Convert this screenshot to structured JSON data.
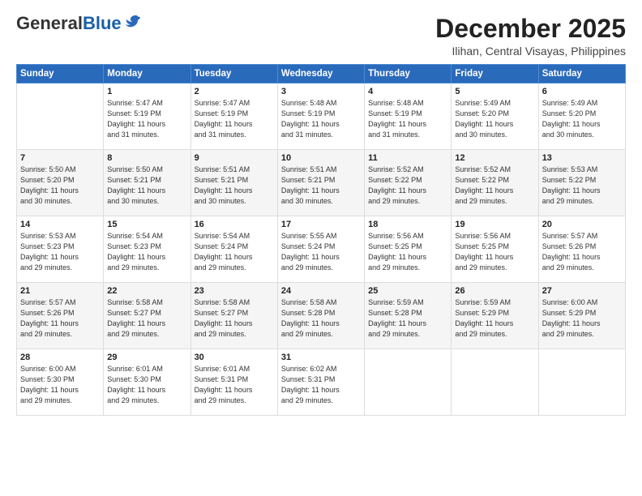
{
  "header": {
    "logo_general": "General",
    "logo_blue": "Blue",
    "month": "December 2025",
    "location": "Ilihan, Central Visayas, Philippines"
  },
  "days_of_week": [
    "Sunday",
    "Monday",
    "Tuesday",
    "Wednesday",
    "Thursday",
    "Friday",
    "Saturday"
  ],
  "weeks": [
    [
      {
        "day": "",
        "info": ""
      },
      {
        "day": "1",
        "info": "Sunrise: 5:47 AM\nSunset: 5:19 PM\nDaylight: 11 hours\nand 31 minutes."
      },
      {
        "day": "2",
        "info": "Sunrise: 5:47 AM\nSunset: 5:19 PM\nDaylight: 11 hours\nand 31 minutes."
      },
      {
        "day": "3",
        "info": "Sunrise: 5:48 AM\nSunset: 5:19 PM\nDaylight: 11 hours\nand 31 minutes."
      },
      {
        "day": "4",
        "info": "Sunrise: 5:48 AM\nSunset: 5:19 PM\nDaylight: 11 hours\nand 31 minutes."
      },
      {
        "day": "5",
        "info": "Sunrise: 5:49 AM\nSunset: 5:20 PM\nDaylight: 11 hours\nand 30 minutes."
      },
      {
        "day": "6",
        "info": "Sunrise: 5:49 AM\nSunset: 5:20 PM\nDaylight: 11 hours\nand 30 minutes."
      }
    ],
    [
      {
        "day": "7",
        "info": "Sunrise: 5:50 AM\nSunset: 5:20 PM\nDaylight: 11 hours\nand 30 minutes."
      },
      {
        "day": "8",
        "info": "Sunrise: 5:50 AM\nSunset: 5:21 PM\nDaylight: 11 hours\nand 30 minutes."
      },
      {
        "day": "9",
        "info": "Sunrise: 5:51 AM\nSunset: 5:21 PM\nDaylight: 11 hours\nand 30 minutes."
      },
      {
        "day": "10",
        "info": "Sunrise: 5:51 AM\nSunset: 5:21 PM\nDaylight: 11 hours\nand 30 minutes."
      },
      {
        "day": "11",
        "info": "Sunrise: 5:52 AM\nSunset: 5:22 PM\nDaylight: 11 hours\nand 29 minutes."
      },
      {
        "day": "12",
        "info": "Sunrise: 5:52 AM\nSunset: 5:22 PM\nDaylight: 11 hours\nand 29 minutes."
      },
      {
        "day": "13",
        "info": "Sunrise: 5:53 AM\nSunset: 5:22 PM\nDaylight: 11 hours\nand 29 minutes."
      }
    ],
    [
      {
        "day": "14",
        "info": "Sunrise: 5:53 AM\nSunset: 5:23 PM\nDaylight: 11 hours\nand 29 minutes."
      },
      {
        "day": "15",
        "info": "Sunrise: 5:54 AM\nSunset: 5:23 PM\nDaylight: 11 hours\nand 29 minutes."
      },
      {
        "day": "16",
        "info": "Sunrise: 5:54 AM\nSunset: 5:24 PM\nDaylight: 11 hours\nand 29 minutes."
      },
      {
        "day": "17",
        "info": "Sunrise: 5:55 AM\nSunset: 5:24 PM\nDaylight: 11 hours\nand 29 minutes."
      },
      {
        "day": "18",
        "info": "Sunrise: 5:56 AM\nSunset: 5:25 PM\nDaylight: 11 hours\nand 29 minutes."
      },
      {
        "day": "19",
        "info": "Sunrise: 5:56 AM\nSunset: 5:25 PM\nDaylight: 11 hours\nand 29 minutes."
      },
      {
        "day": "20",
        "info": "Sunrise: 5:57 AM\nSunset: 5:26 PM\nDaylight: 11 hours\nand 29 minutes."
      }
    ],
    [
      {
        "day": "21",
        "info": "Sunrise: 5:57 AM\nSunset: 5:26 PM\nDaylight: 11 hours\nand 29 minutes."
      },
      {
        "day": "22",
        "info": "Sunrise: 5:58 AM\nSunset: 5:27 PM\nDaylight: 11 hours\nand 29 minutes."
      },
      {
        "day": "23",
        "info": "Sunrise: 5:58 AM\nSunset: 5:27 PM\nDaylight: 11 hours\nand 29 minutes."
      },
      {
        "day": "24",
        "info": "Sunrise: 5:58 AM\nSunset: 5:28 PM\nDaylight: 11 hours\nand 29 minutes."
      },
      {
        "day": "25",
        "info": "Sunrise: 5:59 AM\nSunset: 5:28 PM\nDaylight: 11 hours\nand 29 minutes."
      },
      {
        "day": "26",
        "info": "Sunrise: 5:59 AM\nSunset: 5:29 PM\nDaylight: 11 hours\nand 29 minutes."
      },
      {
        "day": "27",
        "info": "Sunrise: 6:00 AM\nSunset: 5:29 PM\nDaylight: 11 hours\nand 29 minutes."
      }
    ],
    [
      {
        "day": "28",
        "info": "Sunrise: 6:00 AM\nSunset: 5:30 PM\nDaylight: 11 hours\nand 29 minutes."
      },
      {
        "day": "29",
        "info": "Sunrise: 6:01 AM\nSunset: 5:30 PM\nDaylight: 11 hours\nand 29 minutes."
      },
      {
        "day": "30",
        "info": "Sunrise: 6:01 AM\nSunset: 5:31 PM\nDaylight: 11 hours\nand 29 minutes."
      },
      {
        "day": "31",
        "info": "Sunrise: 6:02 AM\nSunset: 5:31 PM\nDaylight: 11 hours\nand 29 minutes."
      },
      {
        "day": "",
        "info": ""
      },
      {
        "day": "",
        "info": ""
      },
      {
        "day": "",
        "info": ""
      }
    ]
  ]
}
